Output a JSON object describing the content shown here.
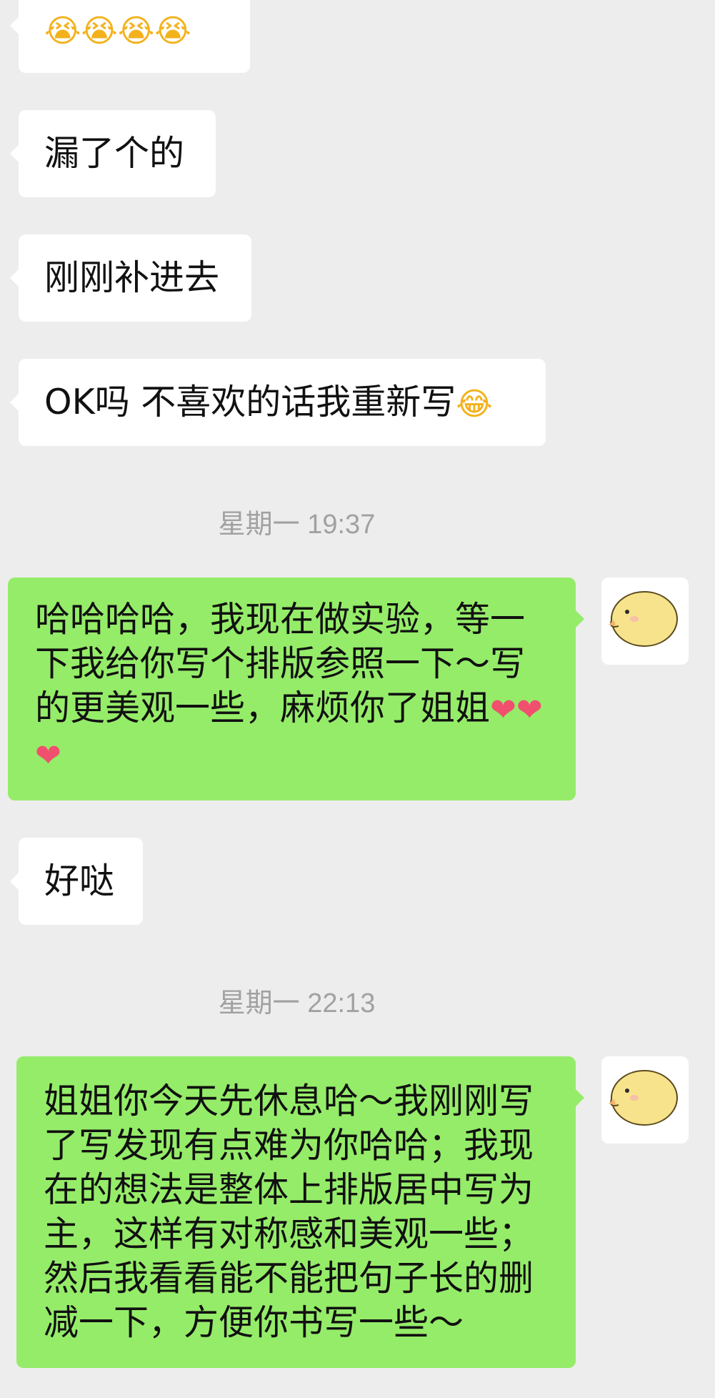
{
  "messages": [
    {
      "side": "in",
      "text": "",
      "emoji": [
        "😭",
        "😭",
        "😭",
        "😭"
      ]
    },
    {
      "side": "in",
      "text": "漏了个的"
    },
    {
      "side": "in",
      "text": "刚刚补进去"
    },
    {
      "side": "in",
      "text": "OK吗 不喜欢的话我重新写",
      "emoji": [
        "😂"
      ]
    },
    {
      "side": "time",
      "text": "星期一 19:37"
    },
    {
      "side": "out",
      "text": "哈哈哈哈，我现在做实验，等一下我给你写个排版参照一下～写的更美观一些，麻烦你了姐姐",
      "emoji": [
        "❤",
        "❤",
        "❤"
      ]
    },
    {
      "side": "in",
      "text": "好哒"
    },
    {
      "side": "time",
      "text": "星期一 22:13"
    },
    {
      "side": "out",
      "text": "姐姐你今天先休息哈～我刚刚写了写发现有点难为你哈哈；我现在的想法是整体上排版居中写为主，这样有对称感和美观一些；然后我看看能不能把句子长的删减一下，方便你书写一些～"
    }
  ],
  "colors": {
    "background": "#ededed",
    "incoming_bubble": "#ffffff",
    "outgoing_bubble": "#95ec69",
    "timestamp_text": "#a1a1a1",
    "avatar_chick": "#f7e38c"
  },
  "avatar": {
    "icon": "yellow-chick-icon"
  }
}
